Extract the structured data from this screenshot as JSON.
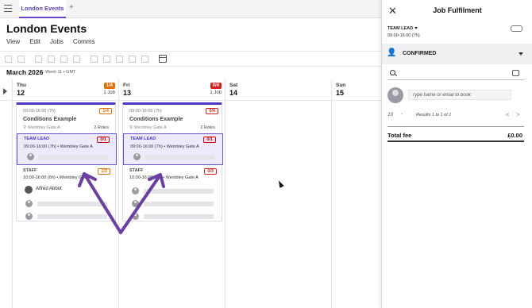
{
  "tabs": [
    {
      "label": "London Events"
    }
  ],
  "page": {
    "title": "London Events"
  },
  "menu": [
    "View",
    "Edit",
    "Jobs",
    "Comms"
  ],
  "calendar": {
    "month": "March 2026",
    "week": "Week 11 • GMT",
    "days": [
      {
        "name": "Thu",
        "date": "12",
        "badge": "1/4",
        "badge_color": "#e07000",
        "jobs": "1 Job"
      },
      {
        "name": "Fri",
        "date": "13",
        "badge": "0/4",
        "badge_color": "#d02020",
        "jobs": "1 Job"
      },
      {
        "name": "Sat",
        "date": "14"
      },
      {
        "name": "Sun",
        "date": "15"
      }
    ]
  },
  "cards": [
    {
      "time": "09:00-16:00 (7h)",
      "badge": "1/4",
      "badge_color": "#e07000",
      "title": "Conditions Example",
      "location": "Wembley Gate A",
      "roles": "2 Roles",
      "lead": {
        "label": "TEAM LEAD",
        "count": "0/1",
        "time": "09:00-16:00 (7h) • Wembley Gate A"
      },
      "staff": {
        "label": "STAFF",
        "count": "1/3",
        "time": "10:00-16:00 (6h) • Wembley Gate A",
        "person": "Alfred Abbot"
      }
    },
    {
      "time": "09:00-16:00 (7h)",
      "badge": "0/4",
      "badge_color": "#d02020",
      "title": "Conditions Example",
      "location": "Wembley Gate A",
      "roles": "2 Roles",
      "lead": {
        "label": "TEAM LEAD",
        "count": "0/1",
        "time": "09:00-16:00 (7h) • Wembley Gate A"
      },
      "staff": {
        "label": "STAFF",
        "count": "0/3",
        "time": "10:00-16:00 (6h) • Wembley Gate A"
      }
    }
  ],
  "panel": {
    "title": "Job Fulfilment",
    "role": "TEAM LEAD",
    "role_time": "09:00-16:00 (7h)",
    "status": "CONFIRMED",
    "input_placeholder": "Type name or email to book",
    "per_page": "10",
    "results": "Results 1 to 1 of 1",
    "total_label": "Total fee",
    "total_value": "£0.00"
  },
  "colors": {
    "accent": "#6a3fc0",
    "arrow": "#6b3fa0"
  }
}
